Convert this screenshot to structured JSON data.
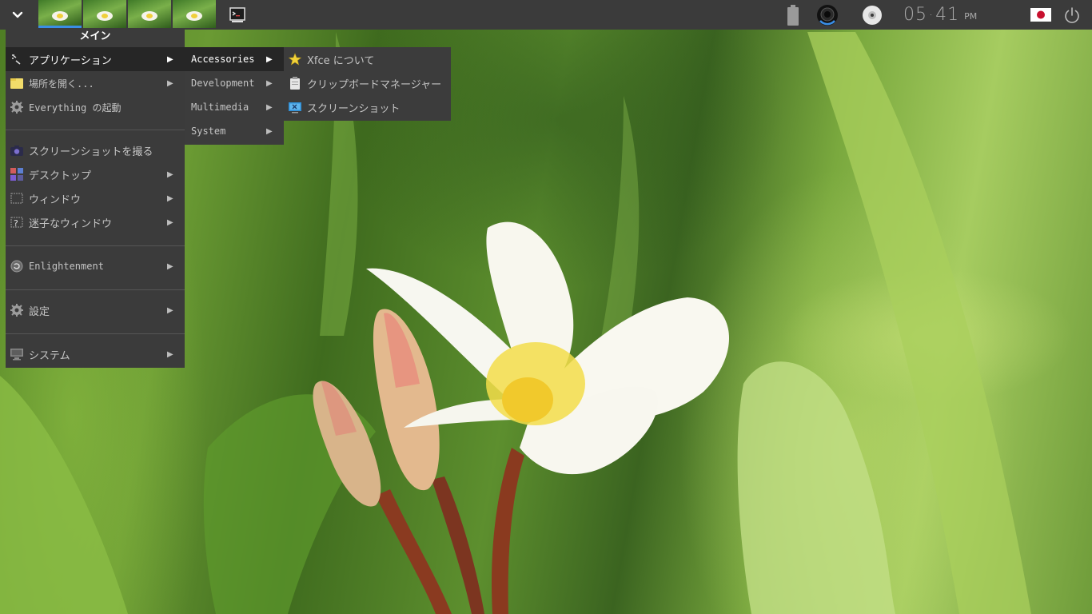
{
  "panel": {
    "workspaces": [
      {
        "name": "workspace-1",
        "active": true
      },
      {
        "name": "workspace-2",
        "active": false
      },
      {
        "name": "workspace-3",
        "active": false
      },
      {
        "name": "workspace-4",
        "active": false
      }
    ],
    "clock": {
      "hours": "05",
      "minutes": "41",
      "ampm": "PM"
    },
    "icons": [
      "chevron-down-icon",
      "terminal-icon",
      "battery-icon",
      "camera-icon",
      "disc-icon",
      "japan-flag-icon",
      "power-icon"
    ]
  },
  "main_menu": {
    "title": "メイン",
    "items": [
      {
        "label": "アプリケーション",
        "icon": "applications-icon",
        "submenu": true,
        "selected": true
      },
      {
        "label": "場所を開く...",
        "icon": "folder-icon",
        "submenu": true
      },
      {
        "label": "Everything の起動",
        "icon": "gear-icon",
        "submenu": false
      },
      {
        "label": "スクリーンショットを撮る",
        "icon": "camera-icon",
        "submenu": false
      },
      {
        "label": "デスクトップ",
        "icon": "desktop-icon",
        "submenu": true
      },
      {
        "label": "ウィンドウ",
        "icon": "window-icon",
        "submenu": true
      },
      {
        "label": "迷子なウィンドウ",
        "icon": "lost-window-icon",
        "submenu": true
      },
      {
        "label": "Enlightenment",
        "icon": "enlightenment-icon",
        "submenu": true
      },
      {
        "label": "設定",
        "icon": "settings-gear-icon",
        "submenu": true
      },
      {
        "label": "システム",
        "icon": "monitor-icon",
        "submenu": true
      }
    ]
  },
  "applications_menu": {
    "items": [
      {
        "label": "Accessories",
        "selected": true
      },
      {
        "label": "Development"
      },
      {
        "label": "Multimedia"
      },
      {
        "label": "System"
      }
    ]
  },
  "accessories_menu": {
    "items": [
      {
        "label": "Xfce について",
        "icon": "star-icon"
      },
      {
        "label": "クリップボードマネージャー",
        "icon": "clipboard-icon"
      },
      {
        "label": "スクリーンショット",
        "icon": "screenshot-icon"
      }
    ]
  },
  "colors": {
    "panel_bg": "#3b3b3b",
    "menu_bg": "#3b3b3b",
    "selected_bg": "#262626",
    "accent": "#3a8ee6"
  }
}
